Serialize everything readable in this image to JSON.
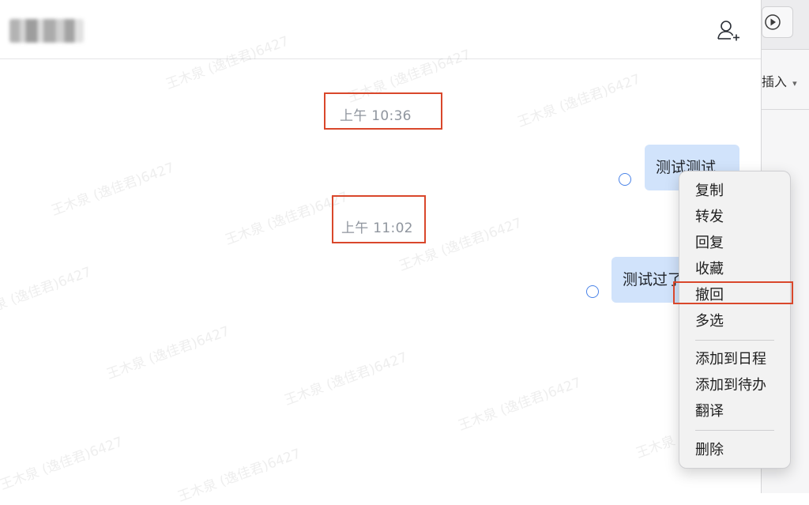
{
  "chat": {
    "header": {
      "add_member_icon": "add-person-icon"
    },
    "messages": [
      {
        "time": "上午 10:36",
        "text": "测试测试"
      },
      {
        "time": "上午 11:02",
        "text": "测试过了"
      }
    ],
    "watermark_text": "王木泉 (逸佳君)6427"
  },
  "side_app": {
    "play_icon": "play-circle-icon",
    "insert_label": "插入",
    "insert_caret": "▾"
  },
  "context_menu": {
    "items": [
      "复制",
      "转发",
      "回复",
      "收藏",
      "撤回",
      "多选"
    ],
    "items2": [
      "添加到日程",
      "添加到待办",
      "翻译"
    ],
    "items3": [
      "删除"
    ]
  },
  "colors": {
    "accent": "#4a83e8",
    "bubble": "#d1e3fb",
    "highlight": "#d9472b"
  }
}
